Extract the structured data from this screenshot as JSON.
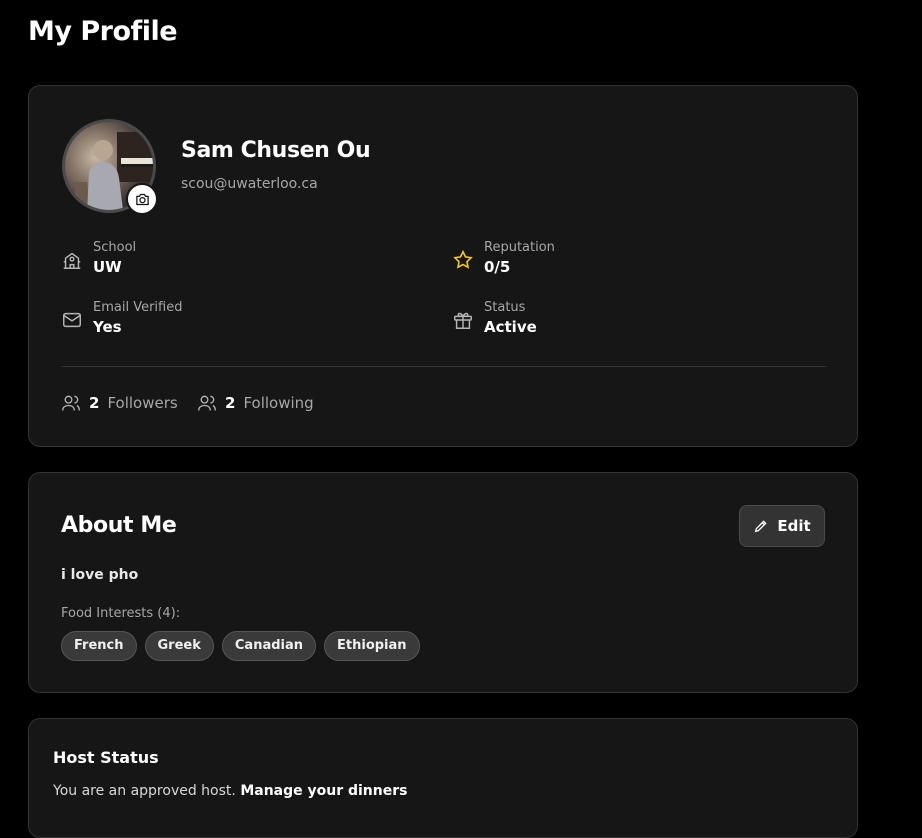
{
  "page": {
    "title": "My Profile"
  },
  "profile": {
    "name": "Sam Chusen Ou",
    "email": "scou@uwaterloo.ca",
    "school": {
      "label": "School",
      "value": "UW",
      "icon": "school-icon"
    },
    "reputation": {
      "label": "Reputation",
      "value": "0/5",
      "icon": "star-icon",
      "color": "#f5c518"
    },
    "email_verified": {
      "label": "Email Verified",
      "value": "Yes",
      "icon": "mail-icon"
    },
    "status": {
      "label": "Status",
      "value": "Active",
      "icon": "gift-icon"
    },
    "followers": {
      "count": "2",
      "label": "Followers"
    },
    "following": {
      "count": "2",
      "label": "Following"
    }
  },
  "about": {
    "title": "About Me",
    "edit_label": "Edit",
    "bio": "i love pho",
    "interests_label": "Food Interests (4):",
    "interests": [
      "French",
      "Greek",
      "Canadian",
      "Ethiopian"
    ]
  },
  "host": {
    "title": "Host Status",
    "text": "You are an approved host.",
    "link": "Manage your dinners"
  },
  "colors": {
    "background": "#000000",
    "card": "#161616",
    "border": "#333333",
    "muted": "#a7a7a7"
  }
}
